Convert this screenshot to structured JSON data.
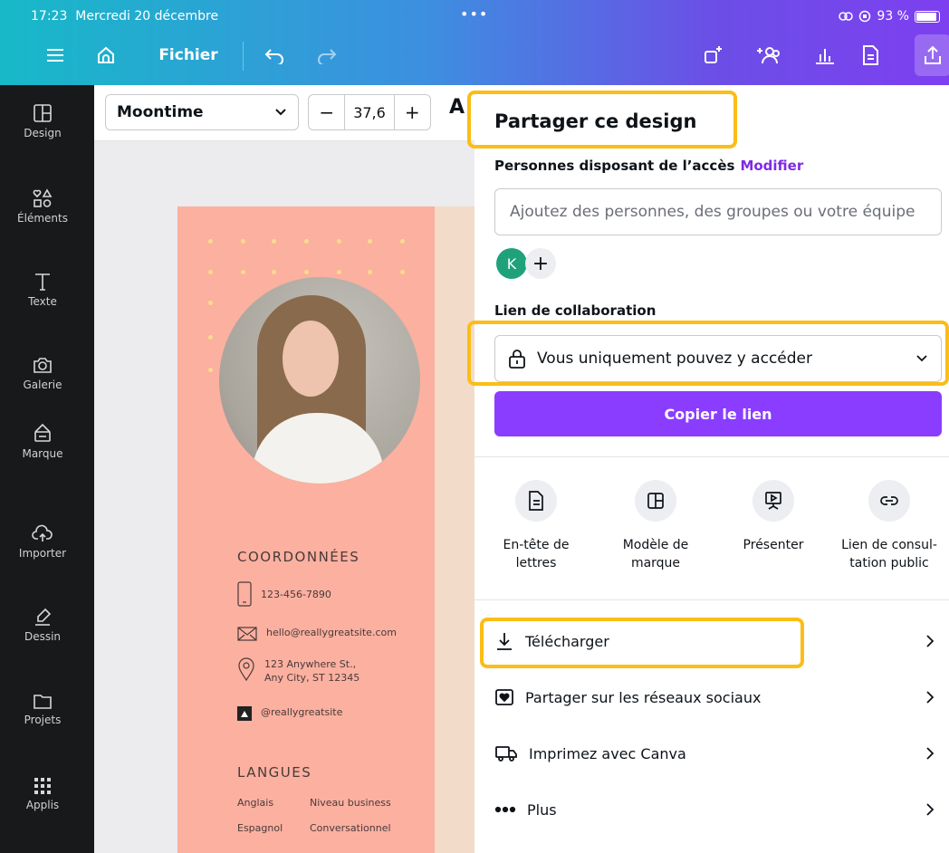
{
  "status": {
    "time": "17:23",
    "date": "Mercredi 20 décembre",
    "dots": "•••",
    "battery": "93 %"
  },
  "toolbar": {
    "file_label": "Fichier"
  },
  "sidebar": {
    "items": [
      {
        "label": "Design",
        "icon": "layout-icon"
      },
      {
        "label": "Éléments",
        "icon": "shapes-icon"
      },
      {
        "label": "Texte",
        "icon": "text-icon"
      },
      {
        "label": "Galerie",
        "icon": "camera-icon"
      },
      {
        "label": "Marque",
        "icon": "brand-icon"
      },
      {
        "label": "Importer",
        "icon": "cloud-upload-icon"
      },
      {
        "label": "Dessin",
        "icon": "draw-icon"
      },
      {
        "label": "Projets",
        "icon": "folder-icon"
      },
      {
        "label": "Applis",
        "icon": "apps-grid-icon"
      }
    ]
  },
  "format": {
    "font": "Moontime",
    "size": "37,6",
    "minus": "−",
    "plus": "+",
    "text_color": "A"
  },
  "resume": {
    "contact_title": "COORDONNÉES",
    "phone": "123-456-7890",
    "email": "hello@reallygreatsite.com",
    "address_line1": "123 Anywhere St.,",
    "address_line2": "Any City, ST 12345",
    "social": "@reallygreatsite",
    "lang_title": "LANGUES",
    "languages": [
      {
        "name": "Anglais",
        "level": "Niveau business"
      },
      {
        "name": "Espagnol",
        "level": "Conversationnel"
      }
    ]
  },
  "share": {
    "title": "Partager ce design",
    "access_label": "Personnes disposant de l’accès",
    "modify": "Modifier",
    "input_placeholder": "Ajoutez des personnes, des groupes ou votre équipe",
    "avatar_initial": "K",
    "add_person": "+",
    "collab_label": "Lien de collaboration",
    "access_value": "Vous uniquement pouvez y accéder",
    "copy_link": "Copier le lien",
    "options": [
      {
        "line1": "En-tête de",
        "line2": "lettres"
      },
      {
        "line1": "Modèle de",
        "line2": "marque"
      },
      {
        "line1": "Présenter",
        "line2": ""
      },
      {
        "line1": "Lien de consul-",
        "line2": "tation public"
      }
    ],
    "rows": [
      {
        "label": "Télécharger"
      },
      {
        "label": "Partager sur les réseaux sociaux"
      },
      {
        "label": "Imprimez avec Canva"
      },
      {
        "label": "Plus"
      }
    ]
  },
  "colors": {
    "accent": "#8b3dff",
    "modifier": "#7d2ae8",
    "highlight": "#fbbd16",
    "resume_bg": "#fbb0a0"
  }
}
